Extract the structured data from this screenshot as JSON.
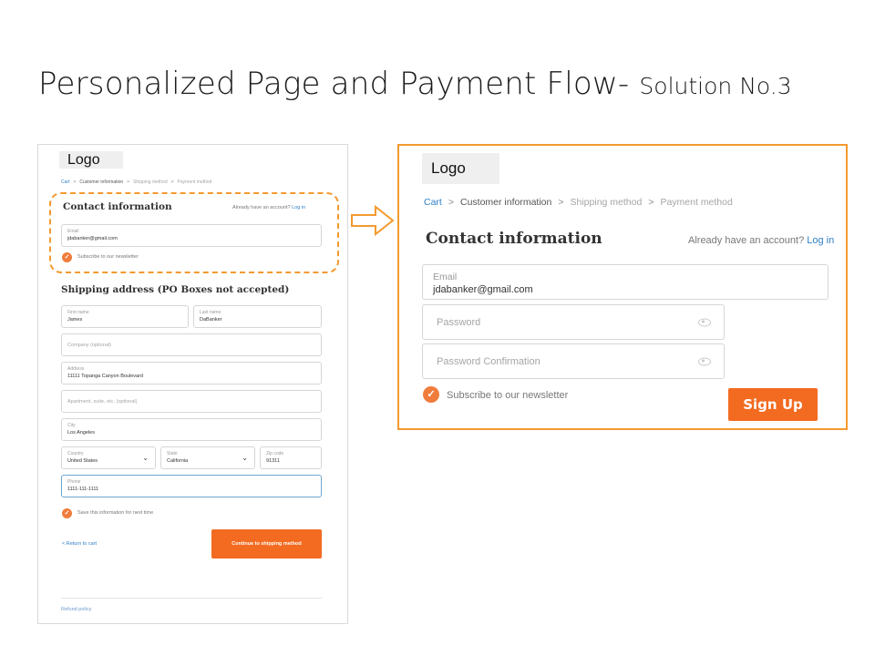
{
  "slide": {
    "title_main": "Personalized Page and Payment Flow- ",
    "title_sub": "Solution No.3"
  },
  "left_mockup": {
    "logo": "Logo",
    "breadcrumb": [
      "Cart",
      "Customer information",
      "Shipping method",
      "Payment method"
    ],
    "contact_heading": "Contact information",
    "account_prompt": "Already have an account?",
    "login_link": "Log in",
    "email": {
      "label": "Email",
      "value": "jdabanker@gmail.com"
    },
    "newsletter_label": "Subscribe to our newsletter",
    "shipping_heading": "Shipping address (PO Boxes not accepted)",
    "first_name": {
      "label": "First name",
      "value": "James"
    },
    "last_name": {
      "label": "Last name",
      "value": "DaBanker"
    },
    "company_placeholder": "Company (optional)",
    "address": {
      "label": "Address",
      "value": "11111 Topanga Canyon Boulevard"
    },
    "apartment_placeholder": "Apartment, suite, etc. (optional)",
    "city": {
      "label": "City",
      "value": "Los Angeles"
    },
    "country": {
      "label": "Country",
      "value": "United States"
    },
    "state": {
      "label": "State",
      "value": "California"
    },
    "zip": {
      "label": "Zip code",
      "value": "91311"
    },
    "phone": {
      "label": "Phone",
      "value": "1111-111-1111"
    },
    "save_info_label": "Save this information for next time",
    "return_link": "< Return to cart",
    "continue_button": "Continue to shipping method",
    "refund_link": "Refund policy"
  },
  "right_mockup": {
    "logo": "Logo",
    "breadcrumb": [
      "Cart",
      "Customer information",
      "Shipping method",
      "Payment method"
    ],
    "contact_heading": "Contact information",
    "account_prompt": "Already have an account?",
    "login_link": "Log in",
    "email": {
      "label": "Email",
      "value": "jdabanker@gmail.com"
    },
    "password_placeholder": "Password",
    "password_confirm_placeholder": "Password Confirmation",
    "newsletter_label": "Subscribe to our newsletter",
    "signup_button": "Sign Up"
  },
  "icons": {
    "breadcrumb_separator": "chevron-right-icon",
    "select_arrow": "chevron-down-icon",
    "password_visibility": "eye-icon",
    "checkbox": "checkmark-icon",
    "flow_arrow": "arrow-right-outline-icon"
  },
  "colors": {
    "accent_orange": "#f26b21",
    "dashed_highlight": "#f39a2f",
    "link_blue": "#2f80c8",
    "checkbox_orange": "#f07c3c"
  }
}
